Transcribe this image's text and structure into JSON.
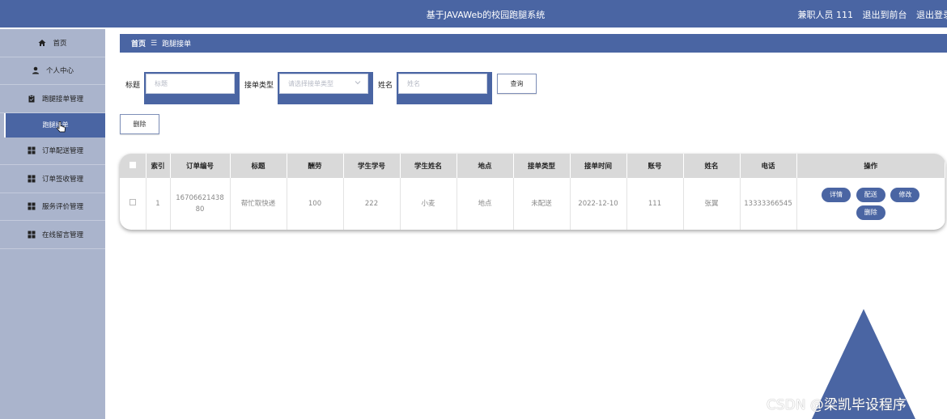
{
  "header": {
    "title": "基于JAVAWeb的校园跑腿系统",
    "user": "兼职人员 111",
    "back_to_front": "退出到前台",
    "logout": "退出登录"
  },
  "sidebar": {
    "items": [
      {
        "label": "首页",
        "icon": "home-icon"
      },
      {
        "label": "个人中心",
        "icon": "user-icon"
      },
      {
        "label": "跑腿接单管理",
        "icon": "clipboard-icon"
      },
      {
        "label": "订单配送管理",
        "icon": "grid-icon"
      },
      {
        "label": "订单签收管理",
        "icon": "grid-icon"
      },
      {
        "label": "服务评价管理",
        "icon": "grid-icon"
      },
      {
        "label": "在线留言管理",
        "icon": "grid-icon"
      }
    ],
    "active_sub": "跑腿接单"
  },
  "breadcrumb": {
    "home": "首页",
    "sep": "☰",
    "current": "跑腿接单"
  },
  "search": {
    "title_label": "标题",
    "title_placeholder": "标题",
    "type_label": "接单类型",
    "type_placeholder": "请选择接单类型",
    "name_label": "姓名",
    "name_placeholder": "姓名",
    "query_button": "查询",
    "delete_button": "删除"
  },
  "table": {
    "headers": [
      "索引",
      "订单编号",
      "标题",
      "酬劳",
      "学生学号",
      "学生姓名",
      "地点",
      "接单类型",
      "接单时间",
      "账号",
      "姓名",
      "电话",
      "操作"
    ],
    "rows": [
      {
        "index": "1",
        "order_no": "1670662143880",
        "title": "帮忙取快递",
        "reward": "100",
        "student_no": "222",
        "student_name": "小麦",
        "location": "地点",
        "type": "未配送",
        "time": "2022-12-10",
        "account": "111",
        "name": "张翼",
        "phone": "13333366545"
      }
    ],
    "actions": {
      "detail": "详情",
      "deliver": "配送",
      "edit": "修改",
      "delete": "删除"
    }
  },
  "watermark": "CSDN @梁凯毕设程序",
  "colors": {
    "brand": "#4a65a3",
    "sidebar": "#aab4cc"
  }
}
